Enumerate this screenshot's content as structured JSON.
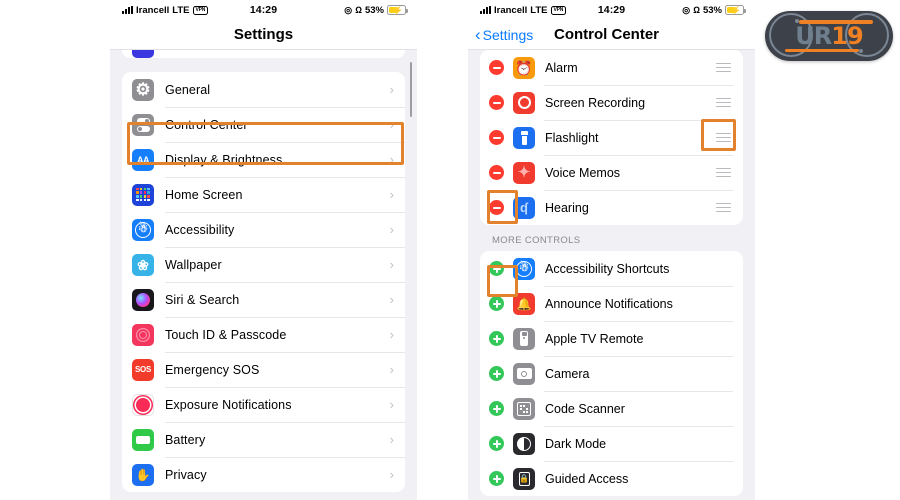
{
  "status_bar": {
    "carrier": "Irancell",
    "network": "LTE",
    "vpn": "VPN",
    "time": "14:29",
    "battery_percent": "53%",
    "location_icon": "location-services-icon",
    "headphones_icon": "headphones-icon",
    "signal_icon": "cellular-signal-icon",
    "battery_icon": "battery-charging-icon"
  },
  "left_phone": {
    "nav": {
      "title": "Settings"
    },
    "items": [
      {
        "label": "General",
        "icon": "gear-icon",
        "color": "#8e8e93",
        "glyph": "⚙"
      },
      {
        "label": "Control Center",
        "icon": "control-center-icon",
        "color": "#8e8e93",
        "glyph": ""
      },
      {
        "label": "Display & Brightness",
        "icon": "display-brightness-icon",
        "color": "#147efb",
        "glyph": "AA"
      },
      {
        "label": "Home Screen",
        "icon": "home-screen-icon",
        "color": "#1d43d8",
        "glyph": ""
      },
      {
        "label": "Accessibility",
        "icon": "accessibility-icon",
        "color": "#157efb",
        "glyph": ""
      },
      {
        "label": "Wallpaper",
        "icon": "wallpaper-icon",
        "color": "#38b3e8",
        "glyph": "❀"
      },
      {
        "label": "Siri & Search",
        "icon": "siri-search-icon",
        "color": "#1c1c22",
        "glyph": ""
      },
      {
        "label": "Touch ID & Passcode",
        "icon": "touch-id-passcode-icon",
        "color": "#f4355e",
        "glyph": ""
      },
      {
        "label": "Emergency SOS",
        "icon": "emergency-sos-icon",
        "color": "#f33b2c",
        "glyph": "SOS"
      },
      {
        "label": "Exposure Notifications",
        "icon": "exposure-notifications-icon",
        "color": "#ffffff",
        "glyph": ""
      },
      {
        "label": "Battery",
        "icon": "battery-settings-icon",
        "color": "#30c948",
        "glyph": ""
      },
      {
        "label": "Privacy",
        "icon": "privacy-icon",
        "color": "#1d6ff2",
        "glyph": "✋"
      }
    ],
    "chevron": "›"
  },
  "right_phone": {
    "nav": {
      "back_label": "Settings",
      "title": "Control Center",
      "back_icon": "chevron-left-icon"
    },
    "included_controls": [
      {
        "label": "Alarm",
        "icon": "alarm-icon",
        "color": "#f99a0b",
        "glyph": "⏰",
        "action": "remove"
      },
      {
        "label": "Screen Recording",
        "icon": "screen-recording-icon",
        "color": "#f03b2e",
        "glyph": "◉",
        "action": "remove"
      },
      {
        "label": "Flashlight",
        "icon": "flashlight-icon",
        "color": "#1d6ff2",
        "glyph": "",
        "action": "remove"
      },
      {
        "label": "Voice Memos",
        "icon": "voice-memos-icon",
        "color": "#f03b2e",
        "glyph": "",
        "action": "remove"
      },
      {
        "label": "Hearing",
        "icon": "hearing-icon",
        "color": "#1d6ff2",
        "glyph": "ʕ",
        "action": "remove"
      }
    ],
    "more_controls_header": "MORE CONTROLS",
    "more_controls": [
      {
        "label": "Accessibility Shortcuts",
        "icon": "accessibility-icon",
        "color": "#157efb",
        "glyph": "",
        "action": "add"
      },
      {
        "label": "Announce Notifications",
        "icon": "announce-notifications-icon",
        "color": "#f03b2e",
        "glyph": "🔔",
        "action": "add"
      },
      {
        "label": "Apple TV Remote",
        "icon": "apple-tv-remote-icon",
        "color": "#8e8e93",
        "glyph": "",
        "action": "add"
      },
      {
        "label": "Camera",
        "icon": "camera-icon",
        "color": "#8e8e93",
        "glyph": "◎",
        "action": "add"
      },
      {
        "label": "Code Scanner",
        "icon": "code-scanner-icon",
        "color": "#8e8e93",
        "glyph": "",
        "action": "add"
      },
      {
        "label": "Dark Mode",
        "icon": "dark-mode-icon",
        "color": "#2a2a2e",
        "glyph": "◑",
        "action": "add"
      },
      {
        "label": "Guided Access",
        "icon": "guided-access-icon",
        "color": "#2a2a2e",
        "glyph": "🔒",
        "action": "add"
      }
    ],
    "drag_handle_icon": "drag-handle-icon"
  },
  "highlights": {
    "accent_color": "#e3822c",
    "boxes": [
      {
        "name": "highlight-control-center-row"
      },
      {
        "name": "highlight-flashlight-drag-handle"
      },
      {
        "name": "highlight-hearing-remove-button"
      },
      {
        "name": "highlight-accessibility-shortcuts-add-button"
      }
    ]
  },
  "watermark": {
    "text_a": "U",
    "text_b": "R",
    "text_c": "19",
    "full": "UR19"
  }
}
